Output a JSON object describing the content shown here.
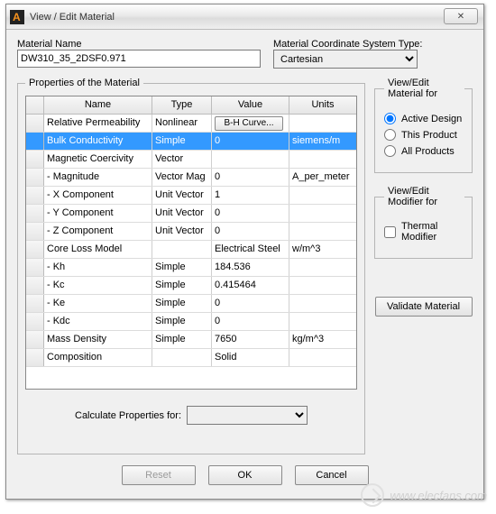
{
  "window": {
    "title": "View / Edit Material",
    "close_glyph": "✕"
  },
  "material_name": {
    "label": "Material Name",
    "value": "DW310_35_2DSF0.971"
  },
  "coord_system": {
    "label": "Material Coordinate System Type:",
    "value": "Cartesian"
  },
  "properties_legend": "Properties of the Material",
  "columns": {
    "name": "Name",
    "type": "Type",
    "value": "Value",
    "units": "Units"
  },
  "rows": [
    {
      "name": "Relative Permeability",
      "type": "Nonlinear",
      "value_button": "B-H Curve...",
      "units": "",
      "selected": false
    },
    {
      "name": "Bulk Conductivity",
      "type": "Simple",
      "value": "0",
      "units": "siemens/m",
      "selected": true
    },
    {
      "name": "Magnetic Coercivity",
      "type": "Vector",
      "value": "",
      "units": ""
    },
    {
      "name": "- Magnitude",
      "type": "Vector Mag",
      "value": "0",
      "units": "A_per_meter"
    },
    {
      "name": "- X Component",
      "type": "Unit Vector",
      "value": "1",
      "units": ""
    },
    {
      "name": "- Y Component",
      "type": "Unit Vector",
      "value": "0",
      "units": ""
    },
    {
      "name": "- Z Component",
      "type": "Unit Vector",
      "value": "0",
      "units": ""
    },
    {
      "name": "Core Loss Model",
      "type": "",
      "value": "Electrical Steel",
      "units": "w/m^3"
    },
    {
      "name": " - Kh",
      "type": "Simple",
      "value": "184.536",
      "units": ""
    },
    {
      "name": " - Kc",
      "type": "Simple",
      "value": "0.415464",
      "units": ""
    },
    {
      "name": " - Ke",
      "type": "Simple",
      "value": "0",
      "units": ""
    },
    {
      "name": " - Kdc",
      "type": "Simple",
      "value": "0",
      "units": ""
    },
    {
      "name": "Mass Density",
      "type": "Simple",
      "value": "7650",
      "units": "kg/m^3"
    },
    {
      "name": "Composition",
      "type": "",
      "value": "Solid",
      "units": ""
    }
  ],
  "calc": {
    "label": "Calculate Properties for:",
    "value": ""
  },
  "view_for": {
    "legend": "View/Edit Material for",
    "options": {
      "active": "Active Design",
      "product": "This Product",
      "all": "All Products"
    },
    "selected": "active"
  },
  "modifier_for": {
    "legend": "View/Edit Modifier for",
    "thermal_label": "Thermal Modifier",
    "thermal_checked": false
  },
  "buttons": {
    "validate": "Validate Material",
    "reset": "Reset",
    "ok": "OK",
    "cancel": "Cancel"
  },
  "watermark": "www.elecfans.com"
}
